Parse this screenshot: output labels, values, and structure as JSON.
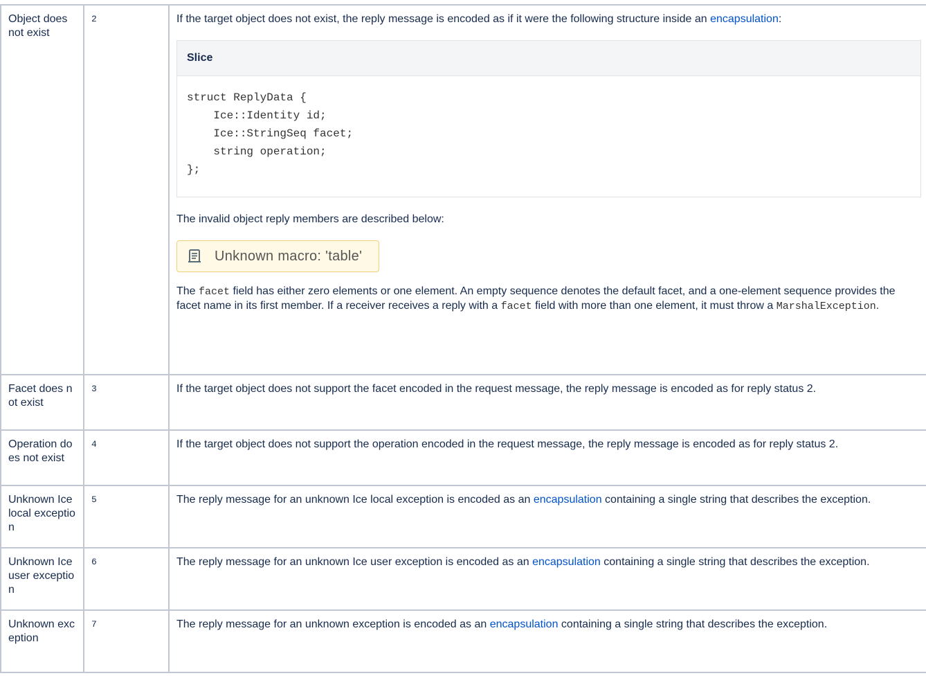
{
  "rows": [
    {
      "name": "Object does not exist",
      "code": "2",
      "intro": "If the target object does not exist, the reply message is encoded as if it were the following structure inside an ",
      "intro_link": "encapsulation",
      "intro_end": ":",
      "code_panel": {
        "title": "Slice",
        "code": "struct ReplyData {\n    Ice::Identity id;\n    Ice::StringSeq facet;\n    string operation;\n};"
      },
      "members_text": "The invalid object reply members are described below:",
      "macro_text": "Unknown macro: 'table'",
      "macro_icon": "scroll-icon",
      "facet": {
        "t1": "The ",
        "c1": "facet",
        "t2": " field has either zero elements or one element. An empty sequence denotes the default facet, and a one-element sequence provides the facet name in its first member. If a receiver receives a reply with a ",
        "c2": "facet",
        "t3": " field with more than one element, it must throw a ",
        "c3": "MarshalException",
        "t4": "."
      }
    },
    {
      "name": "Facet does not exist",
      "code": "3",
      "desc": "If the target object does not support the facet encoded in the request message, the reply message is encoded as for reply status 2."
    },
    {
      "name": "Operation does not exist",
      "code": "4",
      "desc": "If the target object does not support the operation encoded in the request message, the reply message is encoded as for reply status 2."
    },
    {
      "name": "Unknown Ice local exception",
      "code": "5",
      "pre": "The reply message for an unknown Ice local exception is encoded as an ",
      "link": "encapsulation",
      "post": " containing a single string that describes the exception."
    },
    {
      "name": "Unknown Ice user exception",
      "code": "6",
      "pre": "The reply message for an unknown Ice user exception is encoded as an ",
      "link": "encapsulation",
      "post": " containing a single string that describes the exception."
    },
    {
      "name": "Unknown exception",
      "code": "7",
      "pre": "The reply message for an unknown exception is encoded as an ",
      "link": "encapsulation",
      "post": " containing a single string that describes the exception."
    }
  ],
  "colors": {
    "link": "#0052cc",
    "border": "#c1c7d0",
    "macro_bg": "#fff9e6"
  }
}
